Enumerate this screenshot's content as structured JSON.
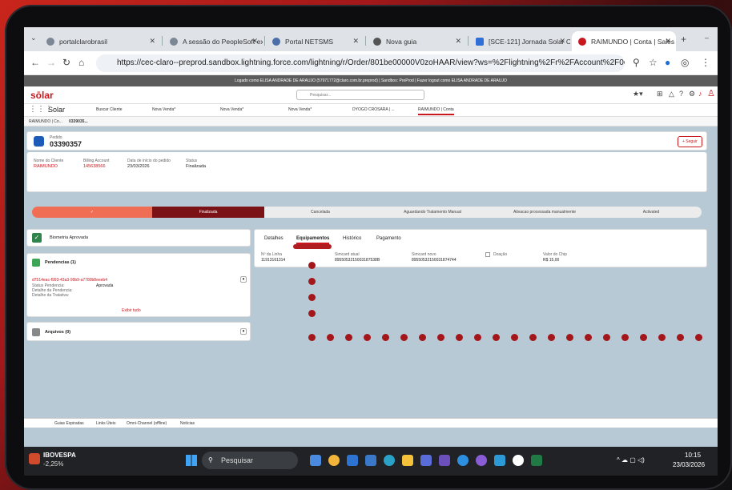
{
  "browser": {
    "tabs": [
      {
        "label": "portalclarobrasil"
      },
      {
        "label": "A sessão do PeopleSoft ex"
      },
      {
        "label": "Portal NETSMS"
      },
      {
        "label": "Nova guia"
      },
      {
        "label": "[SCE-121] Jornada Solar Cl"
      },
      {
        "label": "RAIMUNDO | Conta | Sales"
      }
    ],
    "url": "https://cec-claro--preprod.sandbox.lightning.force.com/lightning/r/Order/801be00000V0zoHAAR/view?ws=%2Flightning%2Fr%2FAccount%2F0017e00001eTW4nAAG%2..."
  },
  "sf": {
    "notice": "Logado como ELISA ANDRADE DE ARAUJO (57971772@claro.com.br.preprod) | Sandbox: PreProd | Fazer logout como ELISA ANDRADE DE ARAUJO",
    "logo": "sōlar",
    "search_placeholder": "Pesquisar...",
    "app_name": "Solar",
    "nav_items": [
      "Buscar Cliente",
      "Nova Venda*",
      "Nova Venda*",
      "Nova Venda*",
      "DYOGO CROSARA | ...",
      "RAIMUNDO | Conta"
    ],
    "subtabs": [
      "RAIMUNDO | Co...",
      "0339035..."
    ]
  },
  "order": {
    "object_label": "Pedido",
    "number": "03390357",
    "follow_label": "+ Seguir",
    "fields": [
      {
        "label": "Nome do Cliente",
        "value": "RAIMUNDO"
      },
      {
        "label": "Billing Account",
        "value": "145638566"
      },
      {
        "label": "Data de início do pedido",
        "value": "23/03/2026"
      },
      {
        "label": "Status",
        "value": "Finalizada"
      }
    ],
    "path": [
      "✓",
      "Finalizada",
      "Cancelada",
      "Aguardando Tratamento Manual",
      "Ativacao processada manualmente",
      "Activated"
    ]
  },
  "left": {
    "biometria": "Biometria Aprovada",
    "pendencias_title": "Pendencias (1)",
    "pendencia_id": "d7514eac-f993-43a3-99b9-a7780b8eeeb4",
    "status_label": "Status Pendencia:",
    "status_value": "Aprovada",
    "detalhe_pend": "Detalhe da Pendencia:",
    "detalhe_trat": "Detalhe da Tratativa:",
    "view_all": "Exibir tudo",
    "arquivos_title": "Arquivos (0)"
  },
  "right": {
    "tabs": [
      "Detalhes",
      "Equipamentos",
      "Histórico",
      "Pagamento"
    ],
    "active_tab": "Equipamentos",
    "fields": [
      {
        "label": "Nº da Linha",
        "value": "11913161314"
      },
      {
        "label": "Simcard atual",
        "value": "8955053215003187538B"
      },
      {
        "label": "Simcard novo",
        "value": "89550532150031874744"
      },
      {
        "label": "Doação",
        "value": ""
      },
      {
        "label": "Valor do Chip",
        "value": "R$ 15,00"
      }
    ]
  },
  "utility": [
    "Guias Expiradas",
    "Links Úteis",
    "Omni-Channel (offline)",
    "Notícias"
  ],
  "taskbar": {
    "stock_name": "IBOVESPA",
    "stock_change": "-2,25%",
    "search": "Pesquisar",
    "time": "10:15",
    "date": "23/03/2026"
  },
  "colors": {
    "brand": "#c9171e",
    "path_dark": "#7a1216",
    "path_orange": "#f06e54",
    "annotation": "#a3171b"
  }
}
